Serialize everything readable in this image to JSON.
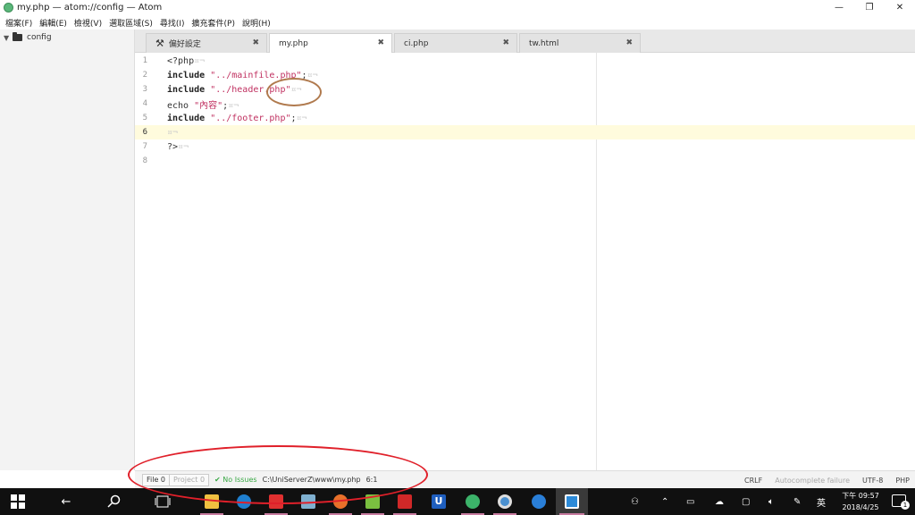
{
  "window": {
    "title": "my.php — atom://config — Atom"
  },
  "menu": [
    "檔案(F)",
    "編輯(E)",
    "檢視(V)",
    "選取區域(S)",
    "尋找(I)",
    "擴充套件(P)",
    "說明(H)"
  ],
  "tree": {
    "root": "config"
  },
  "tabs": [
    {
      "label": "偏好設定",
      "active": false
    },
    {
      "label": "my.php",
      "active": true
    },
    {
      "label": "ci.php",
      "active": false
    },
    {
      "label": "tw.html",
      "active": false
    }
  ],
  "editor": {
    "line_numbers": [
      "1",
      "2",
      "3",
      "4",
      "5",
      "6",
      "7",
      "8"
    ],
    "cursor_line": 6,
    "eol_marker": "¤¬",
    "lines": {
      "l1": {
        "open": "<?php"
      },
      "l2": {
        "kw": "include",
        "str": "\"../mainfile.php\"",
        "end": ";"
      },
      "l3": {
        "kw": "include",
        "str": "\"../header.php\""
      },
      "l4": {
        "kw": "echo",
        "str": "\"內容\"",
        "end": ";"
      },
      "l5": {
        "kw": "include",
        "str": "\"../footer.php\"",
        "end": ";"
      },
      "l7": {
        "close": "?>"
      }
    }
  },
  "statusbar": {
    "file_btn": "File 0",
    "project_btn": "Project 0",
    "issues": "✔ No Issues",
    "path": "C:\\UniServerZ\\www\\my.php",
    "position": "6:1",
    "line_ending": "CRLF",
    "autocomplete": "Autocomplete failure",
    "encoding": "UTF-8",
    "grammar": "PHP"
  },
  "taskbar": {
    "clock_time": "下午 09:57",
    "clock_date": "2018/4/25",
    "ime": "英",
    "notifications": "1"
  },
  "colors": {
    "accent_annotation": "#e0202a",
    "circle_annotation": "#b07a4e",
    "string": "#c03060",
    "ok": "#39a845"
  }
}
